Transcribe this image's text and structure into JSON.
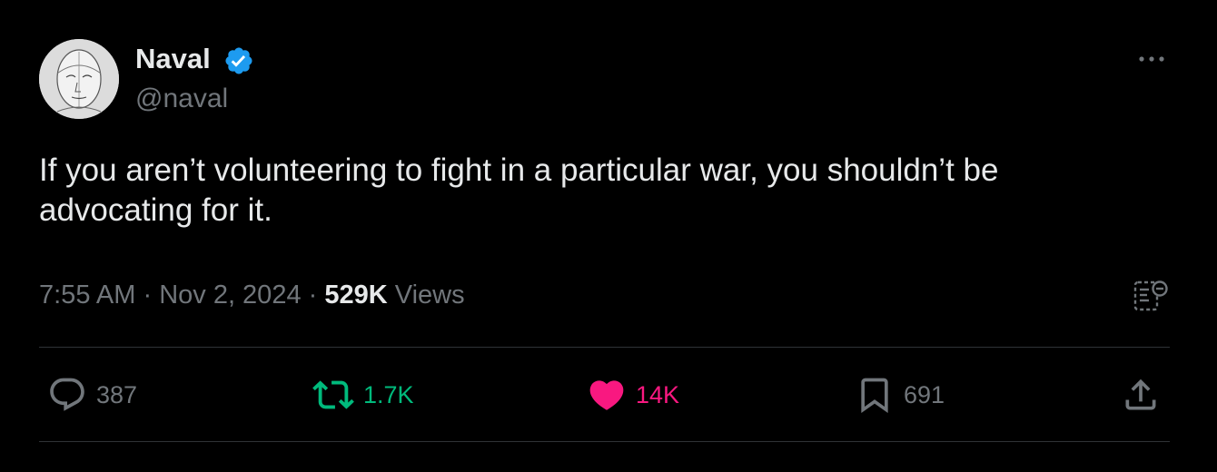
{
  "author": {
    "display_name": "Naval",
    "handle": "@naval",
    "avatar_icon": "avatar-sketch-face",
    "verified_icon": "verified-badge-icon",
    "verified_color": "#1d9bf0"
  },
  "tweet": {
    "text": "If you aren’t volunteering to fight in a particular war, you shouldn’t be advocating for it."
  },
  "meta": {
    "time": "7:55 AM",
    "separator": " · ",
    "date": "Nov 2, 2024",
    "views_count": "529K",
    "views_label": " Views"
  },
  "actions": {
    "reply": {
      "count": "387",
      "icon": "reply-icon"
    },
    "retweet": {
      "count": "1.7K",
      "icon": "retweet-icon",
      "color": "#00ba7c"
    },
    "like": {
      "count": "14K",
      "icon": "heart-filled-icon",
      "color": "#f91880"
    },
    "bookmark": {
      "count": "691",
      "icon": "bookmark-icon"
    },
    "share": {
      "icon": "share-icon"
    }
  },
  "colors": {
    "background": "#000000",
    "text_primary": "#e7e9ea",
    "text_secondary": "#71767b",
    "divider": "#2f3336"
  }
}
